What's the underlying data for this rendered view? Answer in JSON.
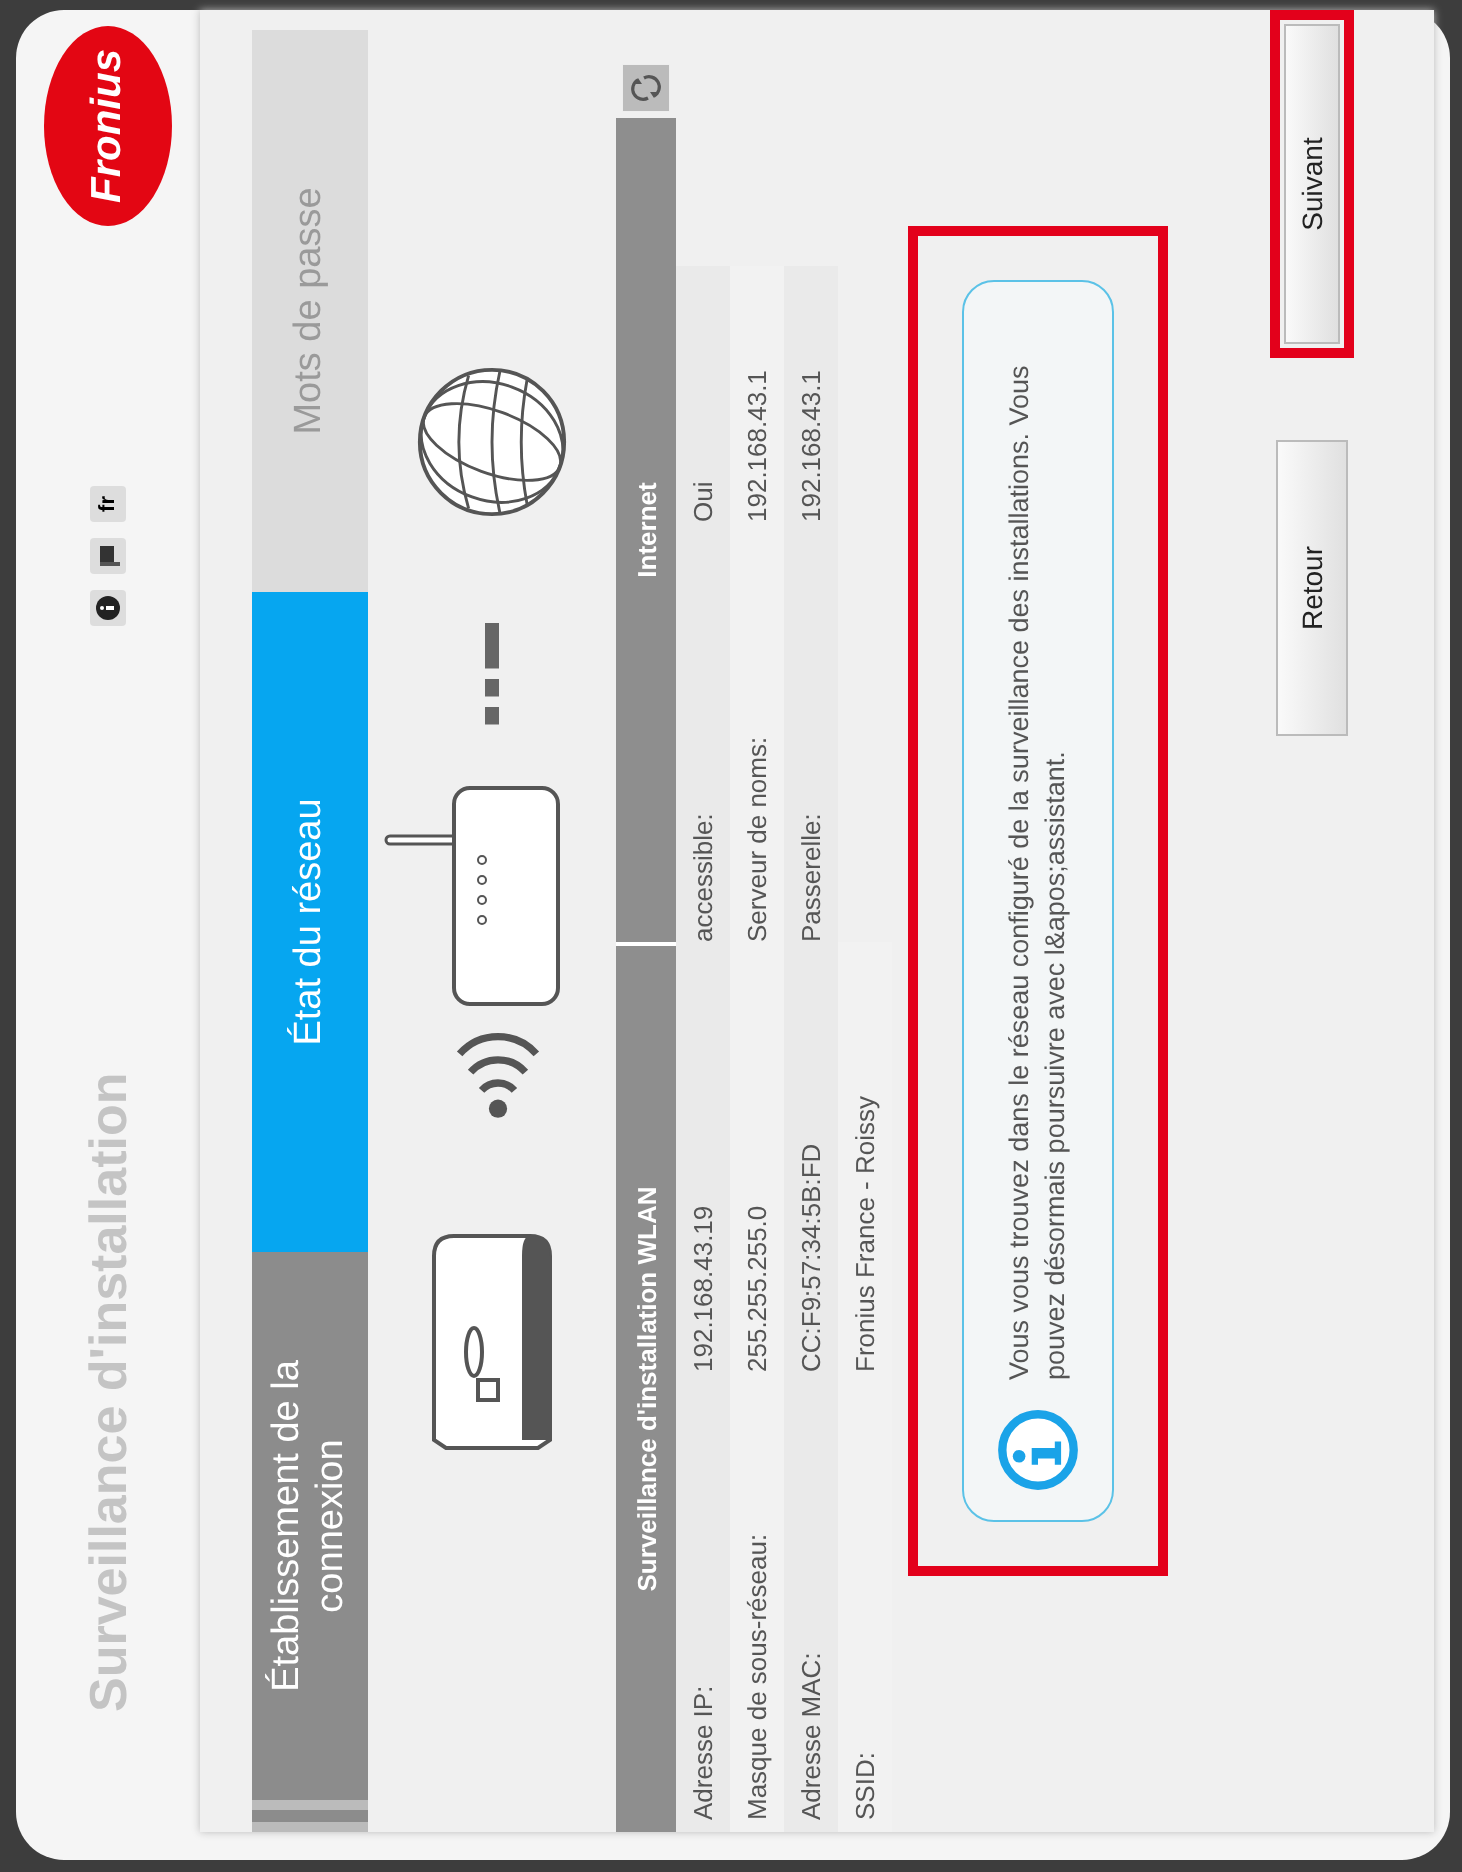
{
  "header": {
    "title": "Surveillance d'installation",
    "language": "fr",
    "logo": "Fronius"
  },
  "steps": [
    {
      "label": "Établissement de la connexion",
      "selected": false
    },
    {
      "label": "État du réseau",
      "selected": true
    },
    {
      "label": "Mots de passe",
      "selected": false
    }
  ],
  "table": {
    "columns": [
      "Surveillance d'installation WLAN",
      "Internet"
    ],
    "left_rows": [
      {
        "label": "Adresse IP:",
        "value": "192.168.43.19"
      },
      {
        "label": "Masque de sous-réseau:",
        "value": "255.255.255.0"
      },
      {
        "label": "Adresse MAC:",
        "value": "CC:F9:57:34:5B:FD"
      },
      {
        "label": "SSID:",
        "value": "Fronius France - Roissy"
      }
    ],
    "right_rows": [
      {
        "label": "accessible:",
        "value": "Oui"
      },
      {
        "label": "Serveur de noms:",
        "value": "192.168.43.1"
      },
      {
        "label": "Passerelle:",
        "value": "192.168.43.1"
      }
    ]
  },
  "info": {
    "text": "Vous vous trouvez dans le réseau configuré de la surveillance des installations. Vous pouvez désormais poursuivre avec l&apos;assistant.",
    "highlighted": true
  },
  "buttons": [
    {
      "label": "Retour",
      "highlighted": false
    },
    {
      "label": "Suivant",
      "highlighted": true
    }
  ]
}
